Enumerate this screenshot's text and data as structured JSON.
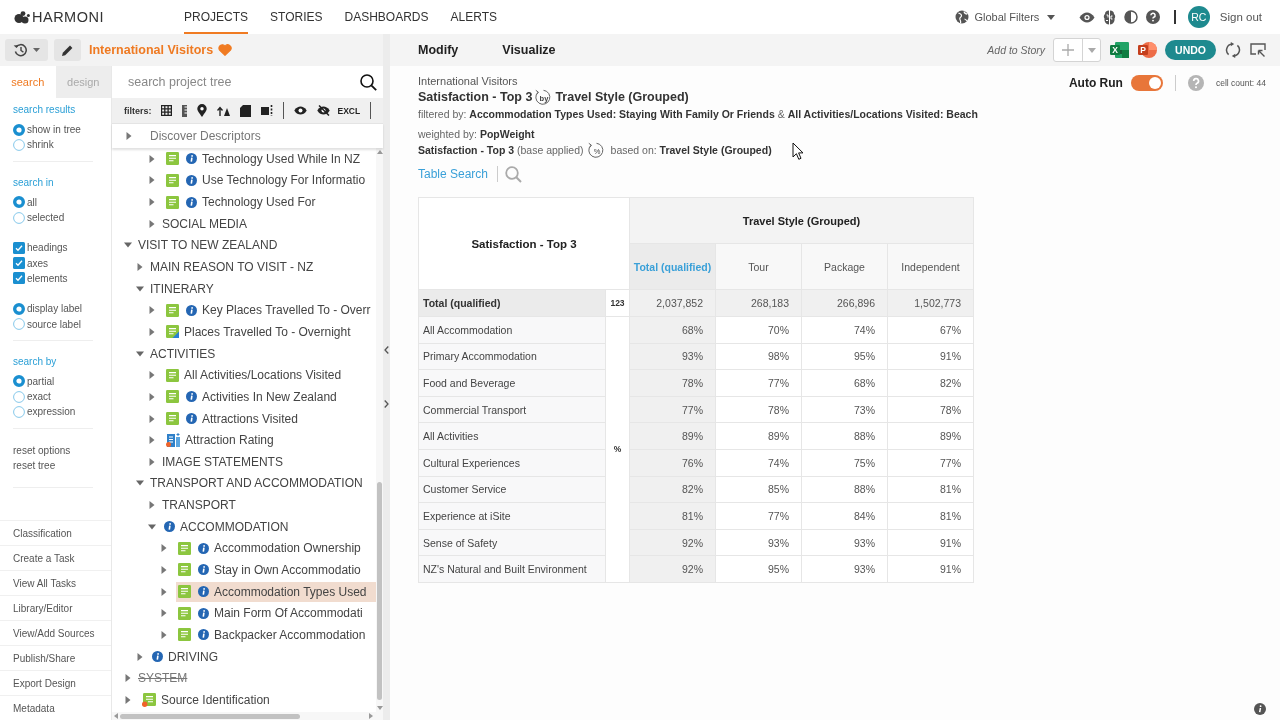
{
  "app": {
    "logo": "HARMONI"
  },
  "nav": [
    {
      "label": "PROJECTS",
      "selected": true
    },
    {
      "label": "STORIES",
      "selected": false
    },
    {
      "label": "DASHBOARDS",
      "selected": false
    },
    {
      "label": "ALERTS",
      "selected": false
    }
  ],
  "global_filters": {
    "label": "Global Filters"
  },
  "user": {
    "initials": "RC",
    "sign_out": "Sign out"
  },
  "project": {
    "title": "International Visitors",
    "favorite": true
  },
  "side_tabs": [
    {
      "label": "search",
      "selected": true
    },
    {
      "label": "design",
      "selected": false
    }
  ],
  "search_options": {
    "sections": [
      {
        "heading": "search results",
        "groups": [
          {
            "kind": "radio",
            "options": [
              {
                "label": "show in tree",
                "selected": true
              },
              {
                "label": "shrink",
                "selected": false
              }
            ]
          }
        ]
      },
      {
        "heading": "search in",
        "groups": [
          {
            "kind": "radio",
            "options": [
              {
                "label": "all",
                "selected": true
              },
              {
                "label": "selected",
                "selected": false
              }
            ]
          },
          {
            "kind": "checkbox",
            "options": [
              {
                "label": "headings",
                "checked": true
              },
              {
                "label": "axes",
                "checked": true
              },
              {
                "label": "elements",
                "checked": true
              }
            ]
          },
          {
            "kind": "radio",
            "options": [
              {
                "label": "display label",
                "selected": true
              },
              {
                "label": "source label",
                "selected": false
              }
            ]
          }
        ]
      },
      {
        "heading": "search by",
        "groups": [
          {
            "kind": "radio",
            "options": [
              {
                "label": "partial",
                "selected": true
              },
              {
                "label": "exact",
                "selected": false
              },
              {
                "label": "expression",
                "selected": false
              }
            ]
          }
        ]
      }
    ],
    "links": [
      "reset options",
      "reset tree"
    ]
  },
  "side_menu": [
    "Classification",
    "Create a Task",
    "View All Tasks",
    "Library/Editor",
    "View/Add Sources",
    "Publish/Share",
    "Export Design",
    "Metadata"
  ],
  "tree_search": {
    "placeholder": "search project tree"
  },
  "filters": {
    "label": "filters:",
    "exclude": "EXCL"
  },
  "tree": {
    "pinned": {
      "label": "Discover Descriptors",
      "expanded": false
    },
    "items": [
      {
        "children": [
          {
            "children": [
              {
                "label": "Technology Used While In NZ",
                "kind": "variable",
                "info": true,
                "expanded": false,
                "selected": false,
                "struck": false
              },
              {
                "label": "Use Technology For Informatio",
                "kind": "variable",
                "info": true,
                "expanded": false,
                "selected": false,
                "struck": false
              },
              {
                "label": "Technology Used For",
                "kind": "variable",
                "info": true,
                "expanded": false,
                "selected": false,
                "struck": false
              },
              {
                "label": "SOCIAL MEDIA",
                "kind": "folder",
                "info": false,
                "expanded": false,
                "selected": false,
                "struck": false
              }
            ]
          }
        ]
      },
      {
        "label": "VISIT TO NEW ZEALAND",
        "kind": "folder",
        "info": false,
        "expanded": true,
        "selected": false,
        "struck": false,
        "children": [
          {
            "label": "MAIN REASON TO VISIT - NZ",
            "kind": "folder",
            "info": false,
            "expanded": false,
            "selected": false,
            "struck": false
          },
          {
            "label": "ITINERARY",
            "kind": "folder",
            "info": false,
            "expanded": true,
            "selected": false,
            "struck": false,
            "children": [
              {
                "label": "Key Places Travelled To - Overr",
                "kind": "variable",
                "info": true,
                "expanded": false,
                "selected": false,
                "struck": false
              },
              {
                "label": "Places Travelled To - Overnight",
                "kind": "edited_variable",
                "info": false,
                "expanded": false,
                "selected": false,
                "struck": false
              }
            ]
          },
          {
            "label": "ACTIVITIES",
            "kind": "folder",
            "info": false,
            "expanded": true,
            "selected": false,
            "struck": false,
            "children": [
              {
                "label": "All Activities/Locations Visited",
                "kind": "variable",
                "info": false,
                "expanded": false,
                "selected": false,
                "struck": false
              },
              {
                "label": "Activities In New Zealand",
                "kind": "variable",
                "info": true,
                "expanded": false,
                "selected": false,
                "struck": false
              },
              {
                "label": "Attractions Visited",
                "kind": "variable",
                "info": true,
                "expanded": false,
                "selected": false,
                "struck": false
              },
              {
                "label": "Attraction Rating",
                "kind": "rating",
                "info": false,
                "expanded": false,
                "selected": false,
                "struck": false
              },
              {
                "label": "IMAGE STATEMENTS",
                "kind": "folder",
                "info": false,
                "expanded": false,
                "selected": false,
                "struck": false
              }
            ]
          },
          {
            "label": "TRANSPORT AND ACCOMMODATION",
            "kind": "folder",
            "info": false,
            "expanded": true,
            "selected": false,
            "struck": false,
            "children": [
              {
                "label": "TRANSPORT",
                "kind": "folder",
                "info": false,
                "expanded": false,
                "selected": false,
                "struck": false
              },
              {
                "label": "ACCOMMODATION",
                "kind": "folder",
                "info": true,
                "expanded": true,
                "selected": false,
                "struck": false,
                "children": [
                  {
                    "label": "Accommodation Ownership",
                    "kind": "variable",
                    "info": true,
                    "expanded": false,
                    "selected": false,
                    "struck": false
                  },
                  {
                    "label": "Stay in Own Accommodatio",
                    "kind": "variable",
                    "info": true,
                    "expanded": false,
                    "selected": false,
                    "struck": false
                  },
                  {
                    "label": "Accommodation Types Used",
                    "kind": "variable",
                    "info": true,
                    "expanded": false,
                    "selected": true,
                    "struck": false
                  },
                  {
                    "label": "Main Form Of Accommodati",
                    "kind": "variable",
                    "info": true,
                    "expanded": false,
                    "selected": false,
                    "struck": false
                  },
                  {
                    "label": "Backpacker Accommodation",
                    "kind": "variable",
                    "info": true,
                    "expanded": false,
                    "selected": false,
                    "struck": false
                  }
                ]
              }
            ]
          },
          {
            "label": "DRIVING",
            "kind": "folder",
            "info": true,
            "expanded": false,
            "selected": false,
            "struck": false
          }
        ]
      },
      {
        "label": "SYSTEM",
        "kind": "folder",
        "info": false,
        "expanded": false,
        "selected": false,
        "struck": true
      },
      {
        "label": "Source Identification",
        "kind": "source",
        "info": false,
        "expanded": false,
        "selected": false,
        "struck": false
      }
    ]
  },
  "view_tabs": [
    "Modify",
    "Visualize"
  ],
  "toolbar": {
    "add_to_story": "Add to Story",
    "exports": [
      {
        "kind": "excel",
        "glyph": "X"
      },
      {
        "kind": "powerpoint",
        "glyph": "P"
      }
    ],
    "undo": "UNDO"
  },
  "auto_run": {
    "label": "Auto Run",
    "on": true
  },
  "cell_count": "cell count: 44",
  "report": {
    "project": "International Visitors",
    "row_variable": "Satisfaction - Top 3",
    "by_icon": "by",
    "column_variable": "Travel Style (Grouped)",
    "filter": "filtered by: **Accommodation Types Used: Staying With Family Or Friends** & **All Activities/Locations Visited: Beach**",
    "weight": "weighted by: **PopWeight**",
    "base": "**Satisfaction - Top 3** (base applied)",
    "percent_icon": "%",
    "based_on": "based on: **Travel Style (Grouped)**",
    "table_search": "Table Search"
  },
  "table": {
    "corner": "Satisfaction - Top 3",
    "banner": "Travel Style (Grouped)",
    "columns": [
      {
        "label": "Total (qualified)",
        "kind": "total"
      },
      {
        "label": "Tour",
        "kind": "category"
      },
      {
        "label": "Package",
        "kind": "category"
      },
      {
        "label": "Independent",
        "kind": "category"
      }
    ],
    "total_row": {
      "label": "Total (qualified)",
      "unit": "123",
      "values": [
        "2,037,852",
        "268,183",
        "266,896",
        "1,502,773"
      ]
    },
    "unit": "%",
    "rows": [
      {
        "label": "All Accommodation",
        "values": [
          "68%",
          "70%",
          "74%",
          "67%"
        ]
      },
      {
        "label": "Primary Accommodation",
        "values": [
          "93%",
          "98%",
          "95%",
          "91%"
        ]
      },
      {
        "label": "Food and Beverage",
        "values": [
          "78%",
          "77%",
          "68%",
          "82%"
        ]
      },
      {
        "label": "Commercial Transport",
        "values": [
          "77%",
          "78%",
          "73%",
          "78%"
        ]
      },
      {
        "label": "All Activities",
        "values": [
          "89%",
          "89%",
          "88%",
          "89%"
        ]
      },
      {
        "label": "Cultural Experiences",
        "values": [
          "76%",
          "74%",
          "75%",
          "77%"
        ]
      },
      {
        "label": "Customer Service",
        "values": [
          "82%",
          "85%",
          "88%",
          "81%"
        ]
      },
      {
        "label": "Experience at iSite",
        "values": [
          "81%",
          "77%",
          "84%",
          "81%"
        ]
      },
      {
        "label": "Sense of Safety",
        "values": [
          "92%",
          "93%",
          "93%",
          "91%"
        ]
      },
      {
        "label": "NZ's Natural and Built Environment",
        "values": [
          "92%",
          "95%",
          "93%",
          "91%"
        ]
      }
    ]
  }
}
